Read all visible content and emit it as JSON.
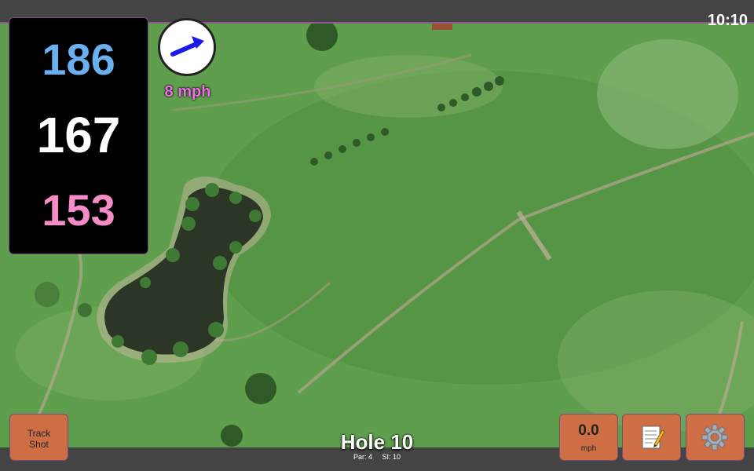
{
  "status_bar": {
    "time": "10:10"
  },
  "distances": {
    "back": "186",
    "middle": "167",
    "front": "153"
  },
  "wind": {
    "speed_label": "8 mph",
    "arrow_color": "#1a1ae6"
  },
  "buttons": {
    "track_shot_line1": "Track",
    "track_shot_line2": "Shot",
    "speed_value": "0.0",
    "speed_unit": "mph",
    "notes_icon": "notepad-icon",
    "settings_icon": "gear-icon"
  },
  "hole": {
    "title": "Hole 10",
    "par": "Par: 4",
    "si": "SI: 10"
  },
  "colors": {
    "back": "#6ab0f0",
    "middle": "#ffffff",
    "front": "#f58cc8",
    "button": "#cd6e45",
    "wind_text": "#f070e8"
  }
}
